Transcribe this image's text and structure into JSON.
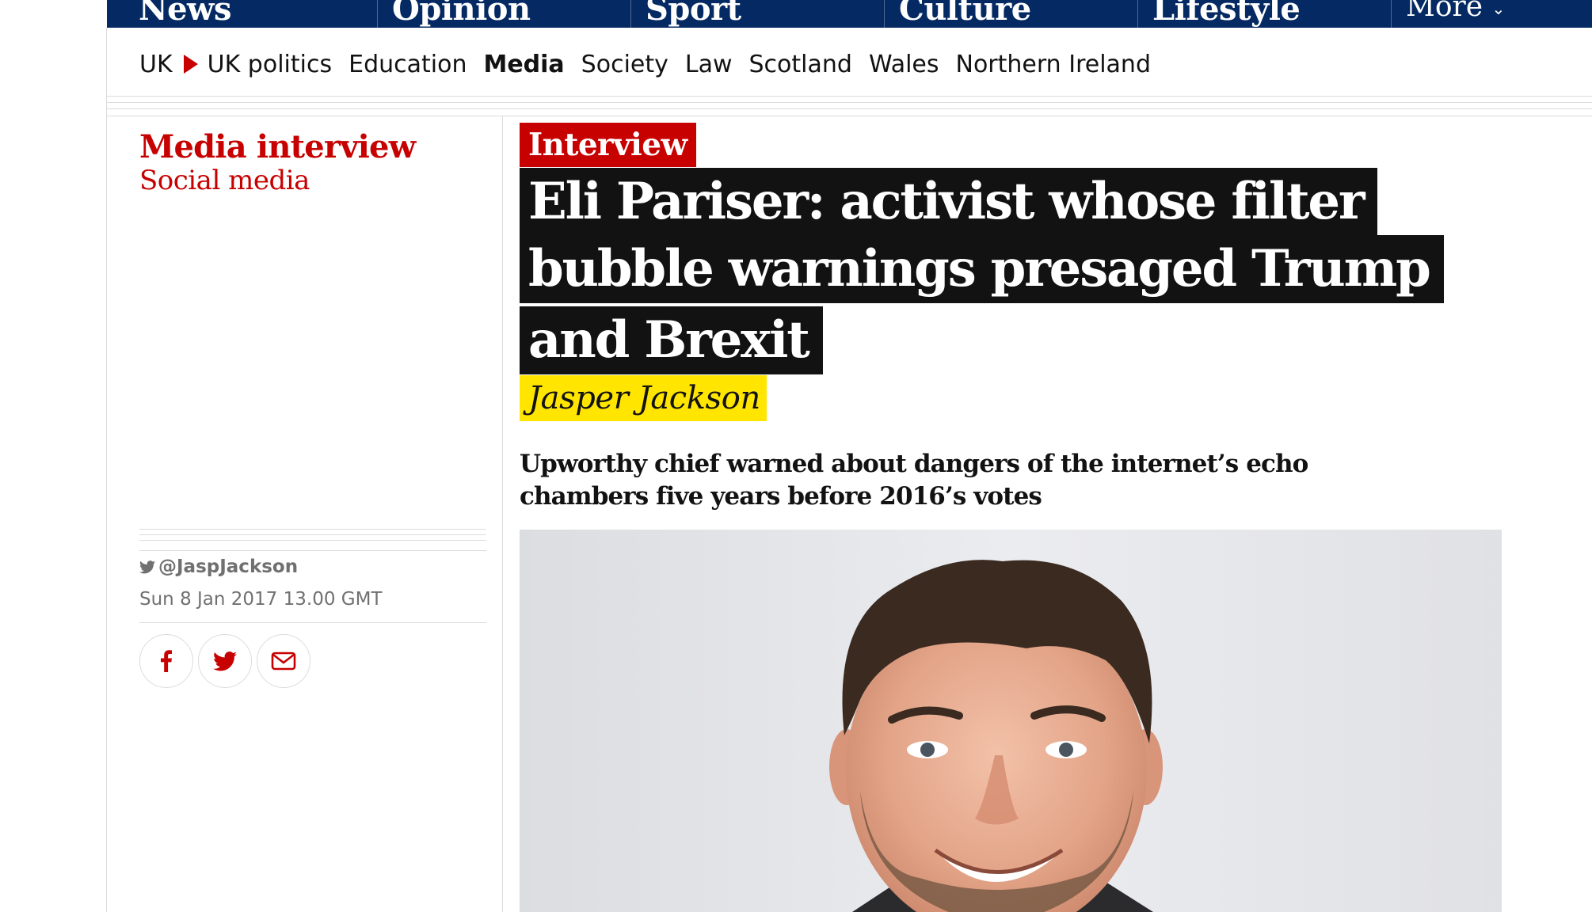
{
  "pillars": [
    {
      "label": "News"
    },
    {
      "label": "Opinion"
    },
    {
      "label": "Sport"
    },
    {
      "label": "Culture"
    },
    {
      "label": "Lifestyle"
    }
  ],
  "pillar_more": "More",
  "subnav": {
    "uk": "UK",
    "items": [
      "UK politics",
      "Education",
      "Media",
      "Society",
      "Law",
      "Scotland",
      "Wales",
      "Northern Ireland"
    ],
    "active": "Media"
  },
  "series": {
    "label": "Media interview",
    "sub": "Social media"
  },
  "meta": {
    "twitter": "@JaspJackson",
    "date": "Sun 8 Jan 2017 13.00 GMT"
  },
  "article": {
    "kicker": "Interview",
    "headline_lines": [
      "Eli Pariser: activist whose filter",
      "bubble warnings presaged Trump",
      "and Brexit"
    ],
    "byline": "Jasper Jackson",
    "standfirst_lines": [
      "Upworthy chief warned about dangers of the internet’s echo",
      "chambers five years before 2016’s votes"
    ]
  },
  "colors": {
    "brand_navy": "#052962",
    "news_red": "#c70000",
    "byline_yellow": "#ffe500",
    "headline_bg": "#121212"
  },
  "icons": {
    "twitter": "twitter-bird-icon",
    "share": [
      "facebook-icon",
      "twitter-icon",
      "email-icon"
    ]
  }
}
